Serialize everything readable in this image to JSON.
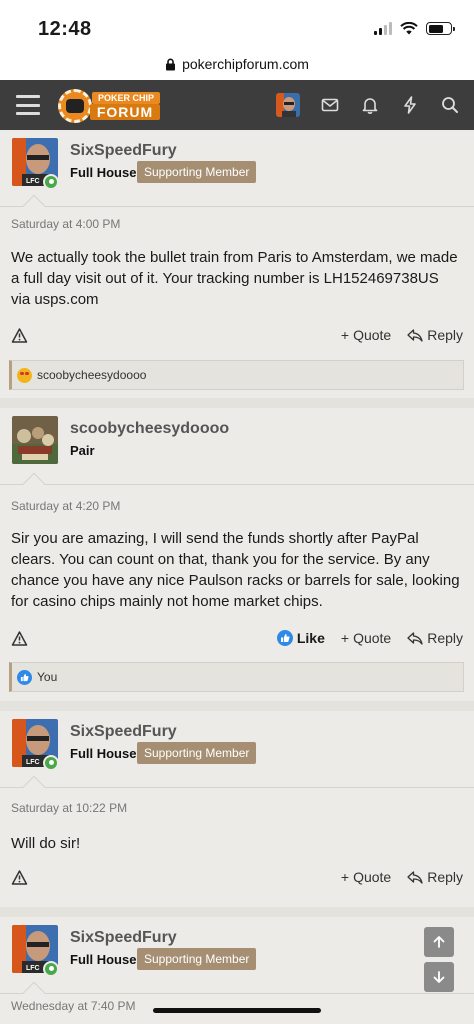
{
  "status": {
    "time": "12:48"
  },
  "browser": {
    "url": "pokerchipforum.com"
  },
  "header": {
    "logo_top": "POKER CHIP",
    "logo_bottom": "FORUM"
  },
  "posts": [
    {
      "username": "SixSpeedFury",
      "user_title": "Full House",
      "badge": "Supporting Member",
      "date": "Saturday at 4:00 PM",
      "body": "We actually took the bullet train from Paris to Amsterdam, we made a full day visit out of it. Your tracking number is LH152469738US via usps.com",
      "quote_label": "Quote",
      "reply_label": "Reply",
      "reaction_user": "scoobycheesydoooo"
    },
    {
      "username": "scoobycheesydoooo",
      "user_title": "Pair",
      "date": "Saturday at 4:20 PM",
      "body": "Sir you are amazing, I will send the funds shortly after PayPal clears. You can count on that, thank you for the service. By any chance you have any nice Paulson racks or barrels for sale, looking for casino chips mainly not home market chips.",
      "like_label": "Like",
      "quote_label": "Quote",
      "reply_label": "Reply",
      "reaction_user": "You"
    },
    {
      "username": "SixSpeedFury",
      "user_title": "Full House",
      "badge": "Supporting Member",
      "date": "Saturday at 10:22 PM",
      "body": "Will do sir!",
      "quote_label": "Quote",
      "reply_label": "Reply"
    },
    {
      "username": "SixSpeedFury",
      "user_title": "Full House",
      "badge": "Supporting Member",
      "date": "Wednesday at 7:40 PM"
    }
  ],
  "colors": {
    "nav_bg": "#3d3d3d",
    "logo_orange": "#e9891f",
    "badge_bg": "#a58e72",
    "online_green": "#4aa84a",
    "like_blue": "#2d8ae6"
  }
}
